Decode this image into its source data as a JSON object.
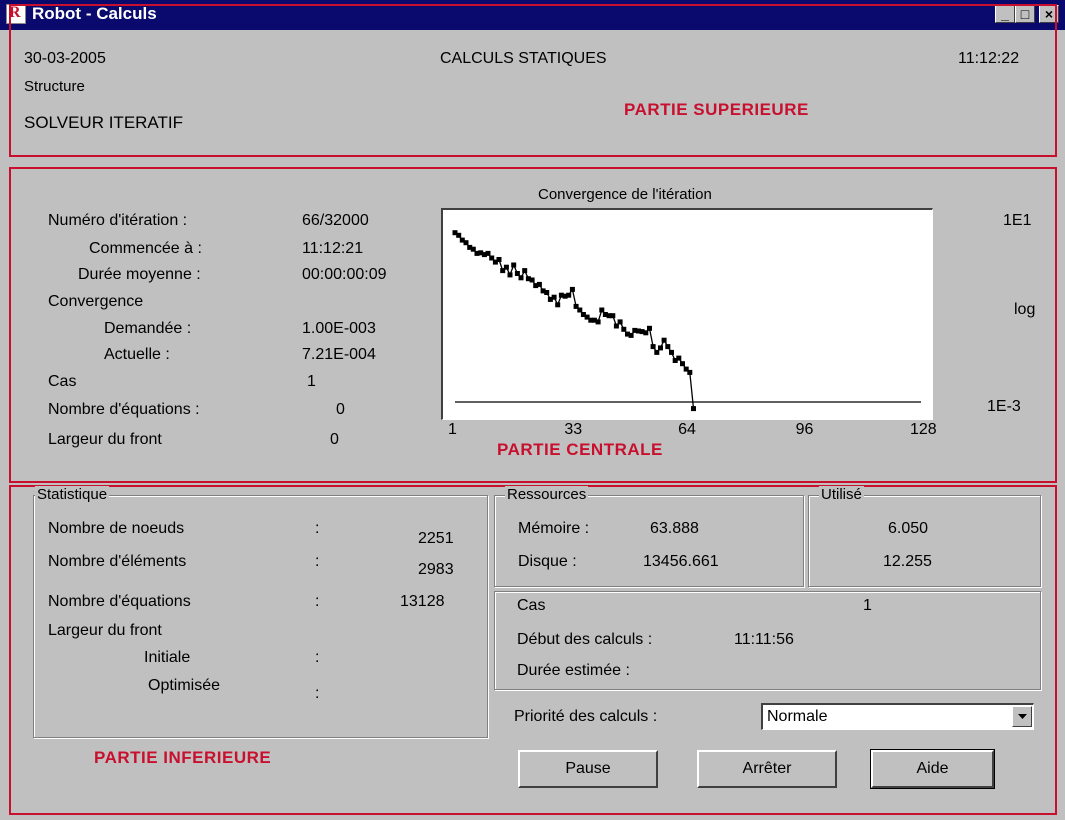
{
  "window": {
    "title": "Robot - Calculs",
    "app_icon_letter": "R",
    "controls": {
      "minimize": "_",
      "maximize": "□",
      "close": "×"
    }
  },
  "header": {
    "date": "30-03-2005",
    "heading": "CALCULS STATIQUES",
    "time": "11:12:22",
    "structure": "Structure",
    "solver": "SOLVEUR ITERATIF"
  },
  "annotations": {
    "top": "PARTIE SUPERIEURE",
    "center": "PARTIE CENTRALE",
    "bottom": "PARTIE INFERIEURE"
  },
  "iteration": {
    "num_label": "Numéro d'itération :",
    "num_value": "66/32000",
    "started_label": "Commencée à :",
    "started_value": "11:12:21",
    "avg_label": "Durée moyenne :",
    "avg_value": "00:00:00:09",
    "conv_label": "Convergence",
    "requested_label": "Demandée :",
    "requested_value": "1.00E-003",
    "actual_label": "Actuelle :",
    "actual_value": "7.21E-004",
    "case_label": "Cas",
    "case_value": "1",
    "equations_label": "Nombre d'équations  :",
    "equations_value": "0",
    "front_label": "Largeur du front",
    "front_value": "0"
  },
  "chart_data": {
    "type": "line",
    "title": "Convergence de l'itération",
    "x_ticks": [
      "1",
      "33",
      "64",
      "96",
      "128"
    ],
    "y_labels": {
      "top": "1E1",
      "scale": "log",
      "bottom": "1E-3"
    },
    "y_scale": "log",
    "xlim": [
      1,
      128
    ],
    "ylim": [
      0.001,
      10
    ],
    "series": [
      {
        "x": [
          1,
          2,
          3,
          4,
          5,
          6,
          7,
          8,
          9,
          10,
          11,
          12,
          13,
          14,
          15,
          16,
          17,
          18,
          19,
          20,
          21,
          22,
          23,
          24,
          25,
          26,
          27,
          28,
          29,
          30,
          31,
          32,
          33,
          34,
          35,
          36,
          37,
          38,
          39,
          40,
          41,
          42,
          43,
          44,
          45,
          46,
          47,
          48,
          49,
          50,
          51,
          52,
          53,
          54,
          55,
          56,
          57,
          58,
          59,
          60,
          61,
          62,
          63,
          64,
          65,
          66
        ],
        "y": [
          4.8,
          4.2,
          3.3,
          2.9,
          2.3,
          2.1,
          1.7,
          1.75,
          1.6,
          1.7,
          1.35,
          1.1,
          1.25,
          0.72,
          0.85,
          0.58,
          0.95,
          0.62,
          0.5,
          0.72,
          0.48,
          0.45,
          0.34,
          0.36,
          0.26,
          0.24,
          0.17,
          0.19,
          0.13,
          0.21,
          0.2,
          0.21,
          0.28,
          0.12,
          0.1,
          0.08,
          0.07,
          0.06,
          0.06,
          0.055,
          0.1,
          0.08,
          0.075,
          0.075,
          0.045,
          0.055,
          0.038,
          0.03,
          0.028,
          0.036,
          0.035,
          0.034,
          0.032,
          0.04,
          0.016,
          0.012,
          0.015,
          0.022,
          0.016,
          0.012,
          0.008,
          0.009,
          0.0068,
          0.0052,
          0.0044,
          0.00072
        ]
      },
      {
        "x": [
          1,
          128
        ],
        "y": [
          0.001,
          0.001
        ]
      }
    ]
  },
  "statistique": {
    "group_label": "Statistique",
    "rows": [
      {
        "label": "Nombre de noeuds",
        "sep": ":",
        "value": "2251"
      },
      {
        "label": "Nombre d'éléments",
        "sep": ":",
        "value": "2983"
      },
      {
        "label": "Nombre d'équations",
        "sep": ":",
        "value": "13128"
      }
    ],
    "front_label": "Largeur du front",
    "initial_label": "Initiale",
    "initial_sep": ":",
    "optimized_label": "Optimisée",
    "optimized_sep": ":"
  },
  "ressources": {
    "group_label": "Ressources",
    "memory_label": "Mémoire :",
    "memory_value": "63.888",
    "disk_label": "Disque :",
    "disk_value": "13456.661"
  },
  "utilise": {
    "group_label": "Utilisé",
    "memory_value": "6.050",
    "disk_value": "12.255"
  },
  "calc": {
    "case_label": "Cas",
    "case_value": "1",
    "start_label": "Début des calculs :",
    "start_value": "11:11:56",
    "estimated_label": "Durée estimée :"
  },
  "priority": {
    "label": "Priorité des calculs :",
    "selected": "Normale"
  },
  "buttons": {
    "pause": "Pause",
    "stop": "Arrêter",
    "help": "Aide"
  }
}
